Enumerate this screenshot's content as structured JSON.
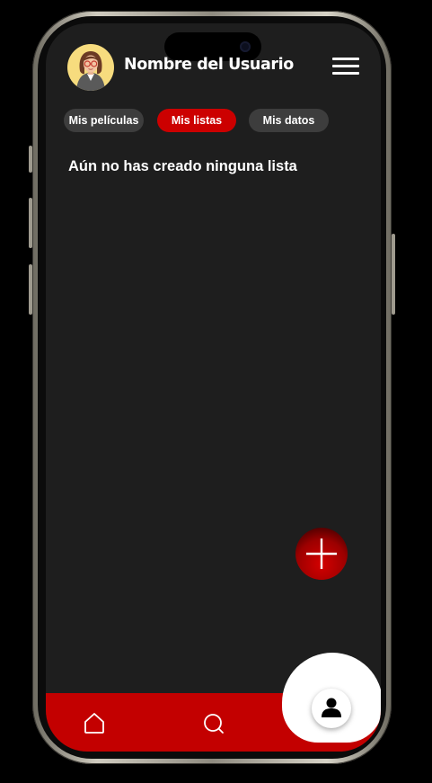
{
  "header": {
    "user_name": "Nombre del Usuario",
    "avatar_icon": "user-avatar-woman-glasses",
    "menu_icon": "hamburger-menu-icon"
  },
  "tabs": [
    {
      "label": "Mis películas",
      "active": false
    },
    {
      "label": "Mis listas",
      "active": true
    },
    {
      "label": "Mis datos",
      "active": false
    }
  ],
  "main": {
    "empty_message": "Aún no has creado ninguna lista"
  },
  "fab": {
    "icon": "plus-icon"
  },
  "bottom_nav": {
    "items": [
      {
        "icon": "home-icon"
      },
      {
        "icon": "search-icon"
      },
      {
        "icon": "user-icon",
        "selected": true
      }
    ]
  },
  "colors": {
    "accent": "#cc0000",
    "background": "#1e1e1e",
    "tab_inactive": "#3d3d3d",
    "text": "#ffffff"
  }
}
